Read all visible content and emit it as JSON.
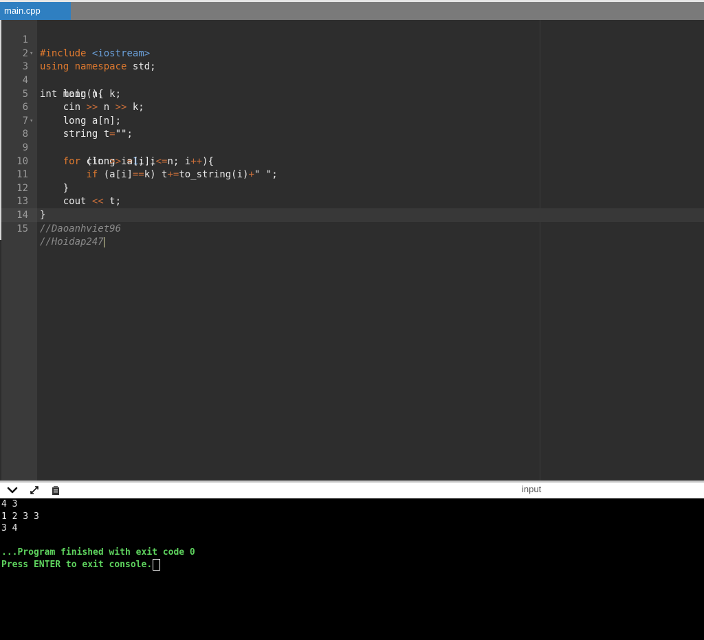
{
  "tab": {
    "filename": "main.cpp"
  },
  "colors": {
    "tab_active": "#2f7fc1",
    "editor_bg": "#2d2d2d",
    "console_bg": "#000000",
    "console_green": "#5ed35e",
    "keyword": "#e07a2f",
    "include_path": "#6a9fd8"
  },
  "editor": {
    "line_numbers": [
      "1",
      "2",
      "3",
      "4",
      "5",
      "6",
      "7",
      "8",
      "9",
      "10",
      "11",
      "12",
      "13",
      "14",
      "15"
    ],
    "tokens": {
      "l1_include": "#include",
      "l1_path": "<iostream>",
      "l2_using": "using",
      "l2_namespace": "namespace",
      "l2_rest": "std;",
      "l3_code": "int main(){",
      "l4_code": "long n, k;",
      "l5_cin": "cin ",
      "l5_op1": ">>",
      "l5_n": " n ",
      "l5_op2": ">>",
      "l5_k": " k;",
      "l6_code": "long a[n];",
      "l7_decl": "string t",
      "l7_op": "=",
      "l7_str": "\"\"",
      "l7_end": ";",
      "l8_for": "for",
      "l8_a": " (long i",
      "l8_eq": "=",
      "l8_one": "1",
      "l8_b": "; i",
      "l8_le": "<=",
      "l8_c": "n; i",
      "l8_inc": "++",
      "l8_d": "){",
      "l9_cin": "cin ",
      "l9_op": ">>",
      "l9_rest": " a[i];",
      "l10_if": "if",
      "l10_a": " (a[i]",
      "l10_eqeq": "==",
      "l10_b": "k) t",
      "l10_pluseq": "+=",
      "l10_c": "to_string(i)",
      "l10_plus": "+",
      "l10_str": "\" \"",
      "l10_end": ";",
      "l11_code": "}",
      "l12_cout": "cout ",
      "l12_op": "<<",
      "l12_rest": " t;",
      "l13_code": "}",
      "l14_comment": "//Daoanhviet96",
      "l15_comment": "//Hoidap247"
    }
  },
  "console": {
    "toolbar": {
      "collapse_icon": "chevron-down-icon",
      "expand_icon": "expand-icon",
      "copy_icon": "clipboard-icon",
      "input_label": "input"
    },
    "lines": [
      "4 3",
      "1 2 3 3",
      "3 4",
      "",
      "...Program finished with exit code 0",
      "Press ENTER to exit console."
    ]
  }
}
